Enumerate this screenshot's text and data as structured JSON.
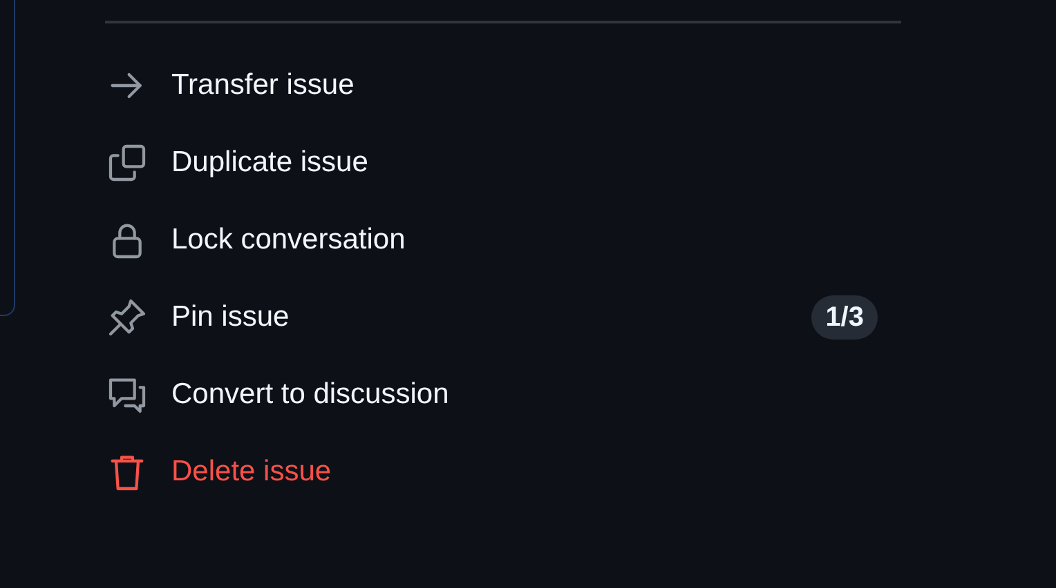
{
  "actions": [
    {
      "kind": "normal",
      "label": "Transfer issue"
    },
    {
      "kind": "normal",
      "label": "Duplicate issue"
    },
    {
      "kind": "normal",
      "label": "Lock conversation"
    },
    {
      "kind": "normal",
      "label": "Pin issue",
      "badge": "1/3"
    },
    {
      "kind": "normal",
      "label": "Convert to discussion"
    },
    {
      "kind": "danger",
      "label": "Delete issue"
    }
  ]
}
